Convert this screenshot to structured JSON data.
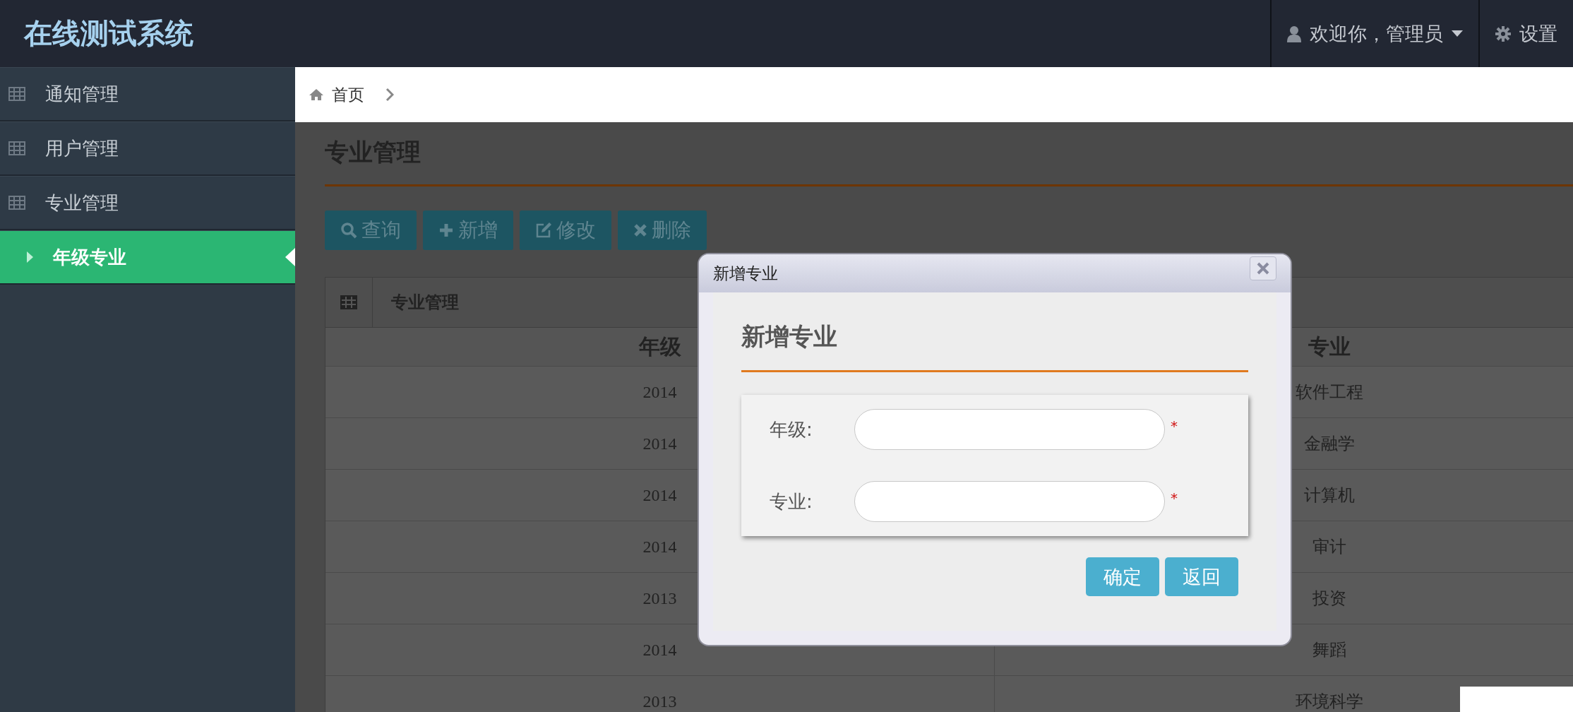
{
  "app": {
    "title": "在线测试系统"
  },
  "user_menu": {
    "label": "欢迎你，管理员"
  },
  "settings": {
    "label": "设置"
  },
  "sidebar": {
    "items": [
      {
        "label": "通知管理",
        "selected": false
      },
      {
        "label": "用户管理",
        "selected": false
      },
      {
        "label": "专业管理",
        "selected": false,
        "children": [
          {
            "label": "年级专业",
            "selected": true
          }
        ]
      }
    ]
  },
  "breadcrumb": [
    "首页"
  ],
  "page_title": "专业管理",
  "toolbar": [
    {
      "kind": "search",
      "label": "查询"
    },
    {
      "kind": "add",
      "label": "新增"
    },
    {
      "kind": "edit",
      "label": "修改"
    },
    {
      "kind": "delete",
      "label": "删除"
    }
  ],
  "table": {
    "title": "专业管理",
    "columns": [
      "年级",
      "专业"
    ],
    "rows": [
      [
        "2014",
        "软件工程"
      ],
      [
        "2014",
        "金融学"
      ],
      [
        "2014",
        "计算机"
      ],
      [
        "2014",
        "审计"
      ],
      [
        "2013",
        "投资"
      ],
      [
        "2014",
        "舞蹈"
      ],
      [
        "2013",
        "环境科学"
      ]
    ]
  },
  "dialog": {
    "title": "新增专业",
    "heading": "新增专业",
    "fields": [
      {
        "label": "年级:",
        "required_mark": "*"
      },
      {
        "label": "专业:",
        "required_mark": "*"
      }
    ],
    "buttons": [
      "确定",
      "返回"
    ]
  }
}
